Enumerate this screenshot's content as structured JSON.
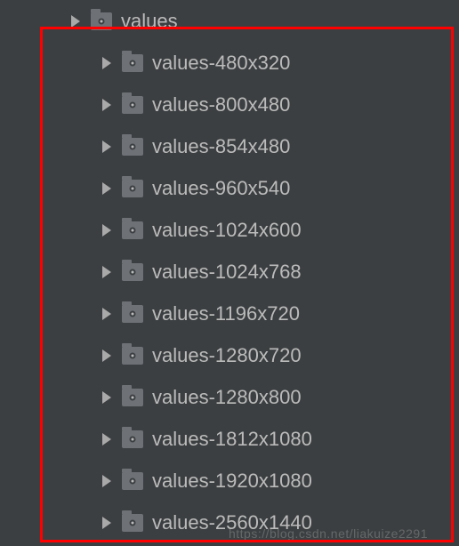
{
  "tree": {
    "root_item": {
      "label": "values",
      "icon": "folder"
    },
    "children": [
      {
        "label": "values-480x320",
        "icon": "folder"
      },
      {
        "label": "values-800x480",
        "icon": "folder"
      },
      {
        "label": "values-854x480",
        "icon": "folder"
      },
      {
        "label": "values-960x540",
        "icon": "folder"
      },
      {
        "label": "values-1024x600",
        "icon": "folder"
      },
      {
        "label": "values-1024x768",
        "icon": "folder"
      },
      {
        "label": "values-1196x720",
        "icon": "folder"
      },
      {
        "label": "values-1280x720",
        "icon": "folder"
      },
      {
        "label": "values-1280x800",
        "icon": "folder"
      },
      {
        "label": "values-1812x1080",
        "icon": "folder"
      },
      {
        "label": "values-1920x1080",
        "icon": "folder"
      },
      {
        "label": "values-2560x1440",
        "icon": "folder"
      }
    ]
  },
  "watermark": "https://blog.csdn.net/liakuize2291"
}
